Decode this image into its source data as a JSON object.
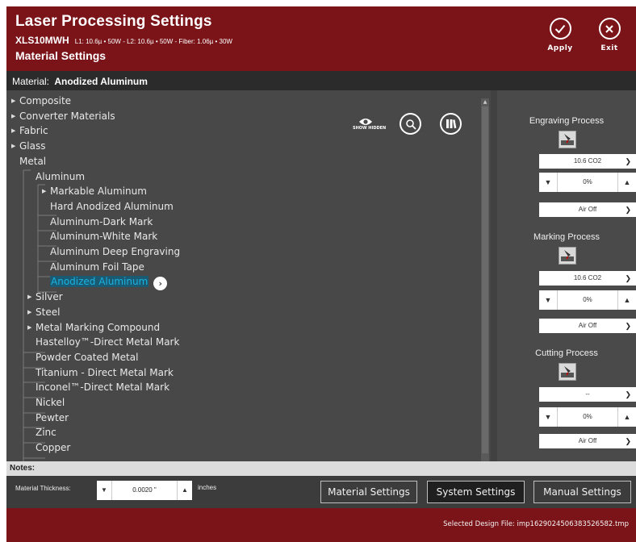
{
  "header": {
    "title": "Laser Processing Settings",
    "model_name": "XLS10MWH",
    "model_specs": "L1: 10.6µ • 50W - L2: 10.6µ • 50W - Fiber: 1.06µ • 30W",
    "subtitle": "Material Settings",
    "apply_label": "Apply",
    "exit_label": "Exit"
  },
  "material_bar": {
    "label": "Material:",
    "value": "Anodized Aluminum"
  },
  "tree": {
    "show_hidden_label": "SHOW HIDDEN",
    "items": [
      {
        "label": "Composite",
        "level": 0,
        "arrow": true
      },
      {
        "label": "Converter Materials",
        "level": 0,
        "arrow": true
      },
      {
        "label": "Fabric",
        "level": 0,
        "arrow": true
      },
      {
        "label": "Glass",
        "level": 0,
        "arrow": true
      },
      {
        "label": "Metal",
        "level": 0,
        "arrow": false
      },
      {
        "label": "Aluminum",
        "level": 1,
        "arrow": false
      },
      {
        "label": "Markable Aluminum",
        "level": 2,
        "arrow": true
      },
      {
        "label": "Hard Anodized Aluminum",
        "level": 2,
        "arrow": false
      },
      {
        "label": "Aluminum-Dark Mark",
        "level": 2,
        "arrow": false
      },
      {
        "label": "Aluminum-White Mark",
        "level": 2,
        "arrow": false
      },
      {
        "label": "Aluminum Deep Engraving",
        "level": 2,
        "arrow": false
      },
      {
        "label": "Aluminum Foil Tape",
        "level": 2,
        "arrow": false
      },
      {
        "label": "Anodized Aluminum",
        "level": 2,
        "arrow": false,
        "selected": true
      },
      {
        "label": "Silver",
        "level": 1,
        "arrow": true
      },
      {
        "label": "Steel",
        "level": 1,
        "arrow": true
      },
      {
        "label": "Metal Marking Compound",
        "level": 1,
        "arrow": true
      },
      {
        "label": "Hastelloy™-Direct Metal Mark",
        "level": 1,
        "arrow": false
      },
      {
        "label": "Powder Coated Metal",
        "level": 1,
        "arrow": false
      },
      {
        "label": "Titanium - Direct Metal Mark",
        "level": 1,
        "arrow": false
      },
      {
        "label": "Inconel™-Direct Metal Mark",
        "level": 1,
        "arrow": false
      },
      {
        "label": "Nickel",
        "level": 1,
        "arrow": false
      },
      {
        "label": "Pewter",
        "level": 1,
        "arrow": false
      },
      {
        "label": "Zinc",
        "level": 1,
        "arrow": false
      },
      {
        "label": "Copper",
        "level": 1,
        "arrow": false
      }
    ]
  },
  "processes": [
    {
      "title": "Engraving Process",
      "wavelength": "10.6 CO2",
      "power": "0%",
      "air": "Air Off"
    },
    {
      "title": "Marking Process",
      "wavelength": "10.6 CO2",
      "power": "0%",
      "air": "Air Off"
    },
    {
      "title": "Cutting Process",
      "wavelength": "--",
      "power": "0%",
      "air": "Air Off"
    }
  ],
  "notes": {
    "label": "Notes:"
  },
  "thickness": {
    "label": "Material Thickness:",
    "value": "0.0020 \"",
    "unit": "inches"
  },
  "bottom_buttons": {
    "material": "Material Settings",
    "system": "System Settings",
    "manual": "Manual Settings"
  },
  "footer": {
    "label": "Selected Design File:",
    "file": "imp1629024506383526582.tmp"
  },
  "colors": {
    "brand_red": "#7a1419",
    "selected_text": "#1ab2e0",
    "panel": "#4a4a4a"
  }
}
